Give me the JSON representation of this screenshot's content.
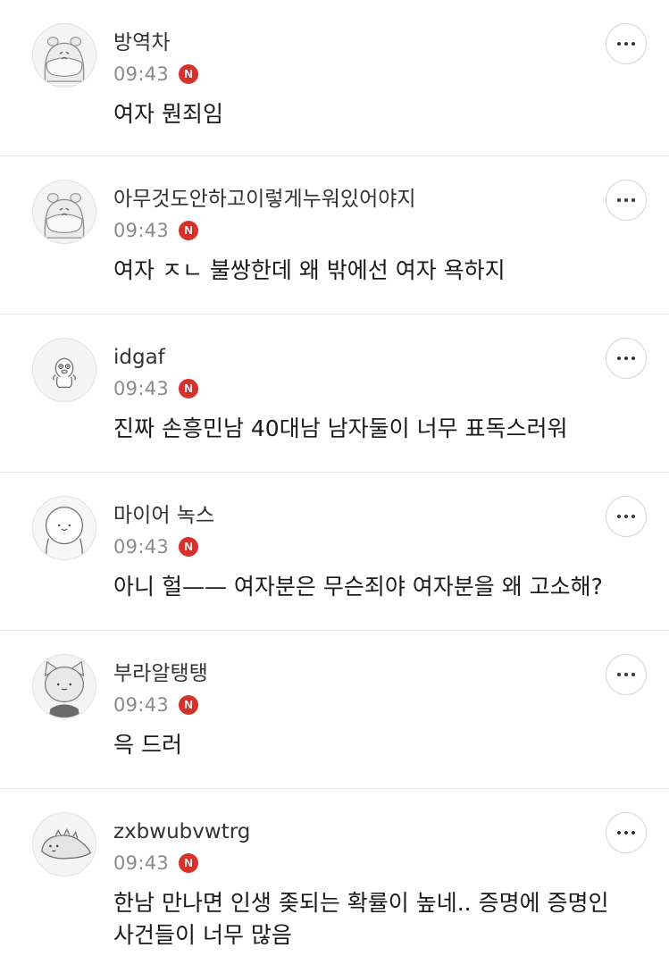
{
  "comments": [
    {
      "avatar_icon": "hamster-avatar-icon",
      "nickname": "방역차",
      "time": "09:43",
      "badge": "N",
      "text": "여자 뭔죄임"
    },
    {
      "avatar_icon": "hamster-avatar-icon",
      "nickname": "아무것도안하고이렇게누워있어야지",
      "time": "09:43",
      "badge": "N",
      "text": "여자 ㅈㄴ 불쌍한데 왜 밖에선 여자 욕하지"
    },
    {
      "avatar_icon": "duck-avatar-icon",
      "nickname": "idgaf",
      "time": "09:43",
      "badge": "N",
      "text": "진짜 손흥민남 40대남 남자둘이 너무 표독스러워"
    },
    {
      "avatar_icon": "bear-avatar-icon",
      "nickname": "마이어 녹스",
      "time": "09:43",
      "badge": "N",
      "text": "아니 헐—— 여자분은 무슨죄야 여자분을 왜 고소해?"
    },
    {
      "avatar_icon": "cat-avatar-icon",
      "nickname": "부라알탱탱",
      "time": "09:43",
      "badge": "N",
      "text": "윽 드러"
    },
    {
      "avatar_icon": "dinosaur-avatar-icon",
      "nickname": "zxbwubvwtrg",
      "time": "09:43",
      "badge": "N",
      "text": "한남 만나면 인생 좆되는 확률이 높네.. 증명에 증명인\n사건들이 너무 많음"
    }
  ],
  "more_button_icon": "more-dots-icon",
  "colors": {
    "badge": "#d6322b",
    "time": "#8a8a8a",
    "nickname": "#333333",
    "divider": "#e6e6e6"
  }
}
